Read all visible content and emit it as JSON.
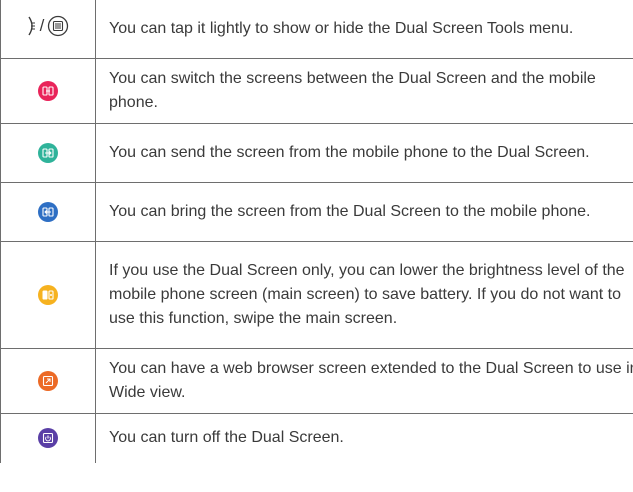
{
  "rows": [
    {
      "icon": "dual-screen-tools-toggle-icon",
      "description": "You can tap it lightly to show or hide the Dual Screen Tools menu."
    },
    {
      "icon": "switch-screens-icon",
      "color": "#e9245a",
      "description": "You can switch the screens between the Dual Screen and the mobile phone."
    },
    {
      "icon": "send-to-dual-screen-icon",
      "color": "#2fb39a",
      "description": "You can send the screen from the mobile phone to the Dual Screen."
    },
    {
      "icon": "bring-from-dual-screen-icon",
      "color": "#2e6fc4",
      "description": "You can bring the screen from the Dual Screen to the mobile phone."
    },
    {
      "icon": "lower-brightness-icon",
      "color": "#f6b21f",
      "description": "If you use the Dual Screen only, you can lower the brightness level of the mobile phone screen (main screen) to save battery. If you do not want to use this function, swipe the main screen."
    },
    {
      "icon": "wide-view-icon",
      "color": "#ec6a26",
      "description": "You can have a web browser screen extended to the Dual Screen to use in Wide view."
    },
    {
      "icon": "turn-off-dual-screen-icon",
      "color": "#5a3fa6",
      "description": "You can turn off the Dual Screen."
    }
  ],
  "menu_separator": "/"
}
